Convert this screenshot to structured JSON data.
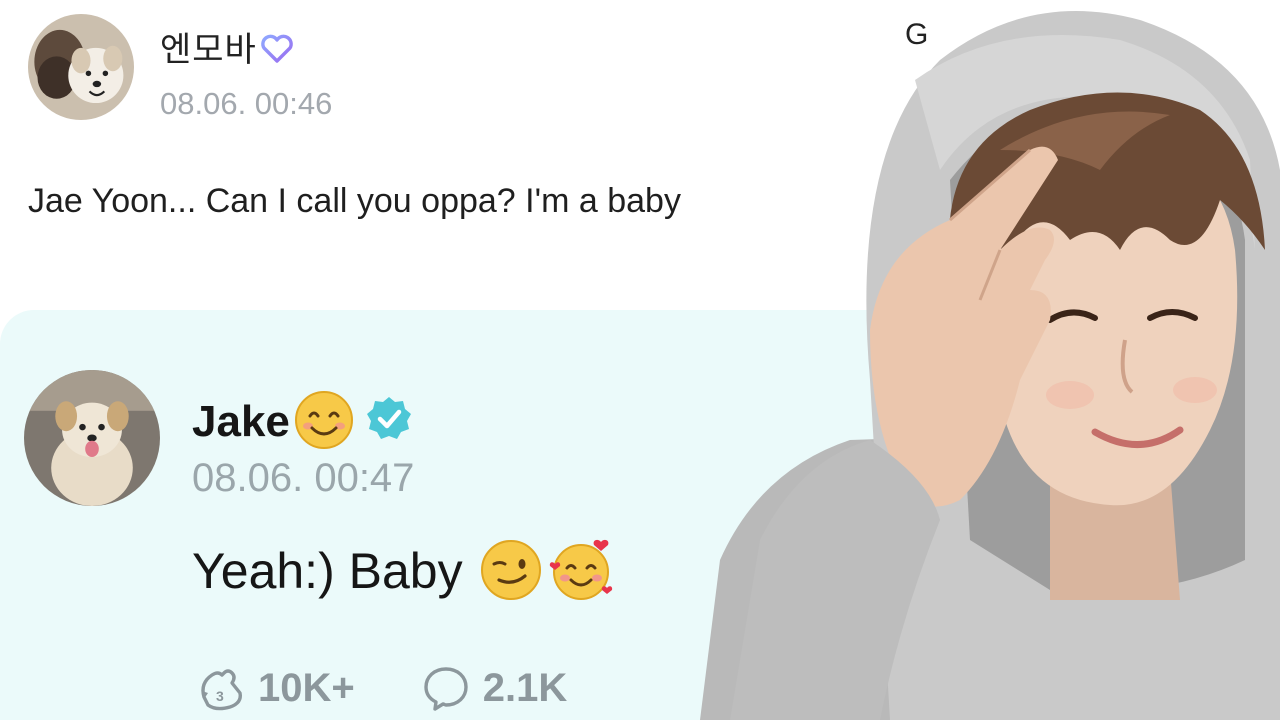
{
  "fan_post": {
    "username": "엔모바",
    "timestamp": "08.06. 00:46",
    "message": "Jae Yoon... Can I call you oppa? I'm a baby"
  },
  "corner_text": "G",
  "artist_reply": {
    "username": "Jake",
    "timestamp": "08.06. 00:47",
    "message": "Yeah:) Baby",
    "likes_count": "10K+",
    "comments_count": "2.1K"
  },
  "icons": {
    "fan_badge": "heart-outline-icon",
    "artist_badge": "verified-icon",
    "likes": "like-icon",
    "comments": "comment-bubble-icon"
  },
  "colors": {
    "reply_background": "#ebfafa",
    "timestamp_gray": "#a3a8ae",
    "verified_teal": "#4cc7d6"
  }
}
